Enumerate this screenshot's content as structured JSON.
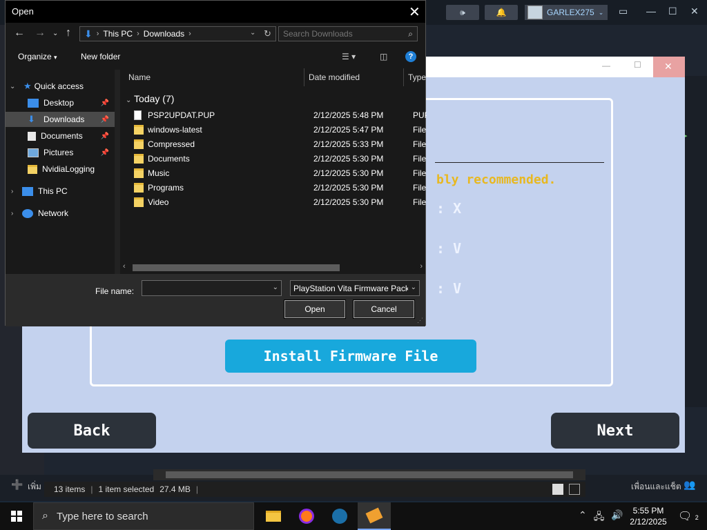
{
  "steam": {
    "profile_name": "GARLEX275",
    "friends_label": "เพื่อนและแช็ต",
    "add_label": "เพิ่ม"
  },
  "installer": {
    "recommend_text": "bly recommended.",
    "status_lines": [
      ": X",
      ": V",
      ": V"
    ],
    "install_button": "Install Firmware File",
    "back_button": "Back",
    "next_button": "Next"
  },
  "explorer_status": {
    "items": "13 items",
    "selected": "1 item selected",
    "size": "27.4 MB"
  },
  "dialog": {
    "title": "Open",
    "breadcrumb": [
      "This PC",
      "Downloads"
    ],
    "search_placeholder": "Search Downloads",
    "toolbar": {
      "organize": "Organize",
      "new_folder": "New folder"
    },
    "nav": [
      {
        "label": "Quick access",
        "selected": false
      },
      {
        "label": "Desktop",
        "selected": false
      },
      {
        "label": "Downloads",
        "selected": true
      },
      {
        "label": "Documents",
        "selected": false
      },
      {
        "label": "Pictures",
        "selected": false
      },
      {
        "label": "NvidiaLogging",
        "selected": false
      },
      {
        "label": "This PC",
        "selected": false
      },
      {
        "label": "Network",
        "selected": false
      }
    ],
    "columns": {
      "name": "Name",
      "date": "Date modified",
      "type": "Type"
    },
    "group_header": "Today (7)",
    "files": [
      {
        "name": "PSP2UPDAT.PUP",
        "date": "2/12/2025 5:48 PM",
        "type": "PUP File",
        "kind": "file"
      },
      {
        "name": "windows-latest",
        "date": "2/12/2025 5:47 PM",
        "type": "File folder",
        "kind": "folder"
      },
      {
        "name": "Compressed",
        "date": "2/12/2025 5:33 PM",
        "type": "File folder",
        "kind": "folder"
      },
      {
        "name": "Documents",
        "date": "2/12/2025 5:30 PM",
        "type": "File folder",
        "kind": "folder"
      },
      {
        "name": "Music",
        "date": "2/12/2025 5:30 PM",
        "type": "File folder",
        "kind": "folder"
      },
      {
        "name": "Programs",
        "date": "2/12/2025 5:30 PM",
        "type": "File folder",
        "kind": "folder"
      },
      {
        "name": "Video",
        "date": "2/12/2025 5:30 PM",
        "type": "File folder",
        "kind": "folder"
      }
    ],
    "filename_label": "File name:",
    "filename_value": "",
    "filetype_value": "PlayStation Vita Firmware Package",
    "open_button": "Open",
    "cancel_button": "Cancel"
  },
  "taskbar": {
    "search_placeholder": "Type here to search",
    "time": "5:55 PM",
    "date": "2/12/2025",
    "notification_count": "2"
  }
}
